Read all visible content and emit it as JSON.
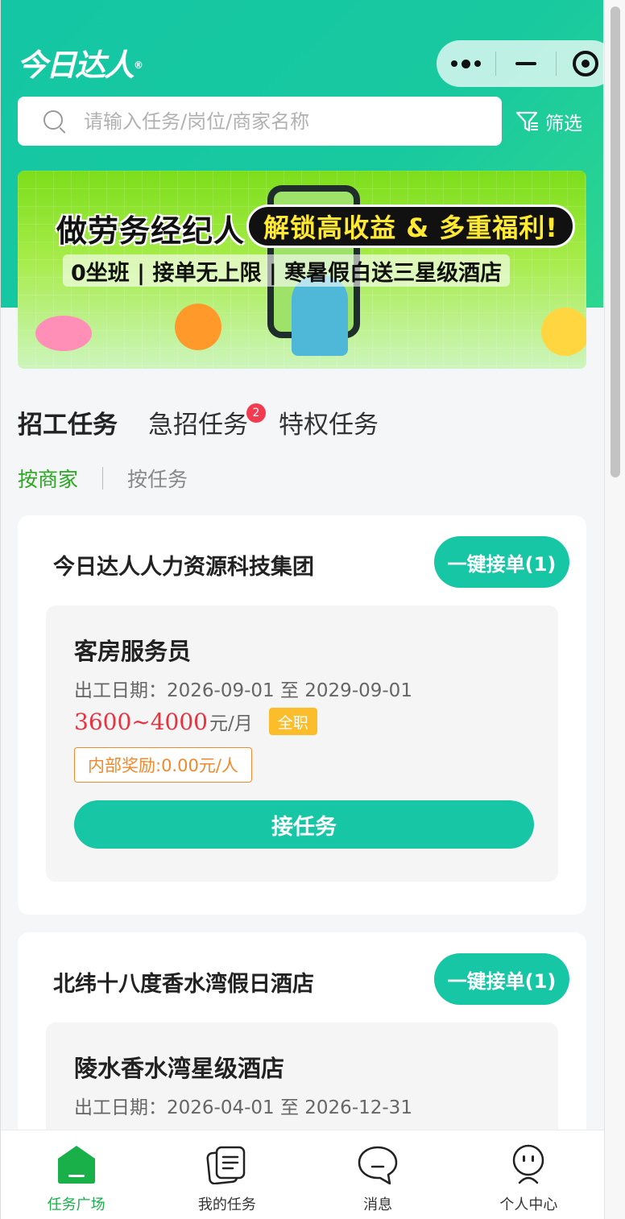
{
  "app": {
    "logo_text": "今日达人",
    "logo_mark": "®"
  },
  "capsule": {
    "more_icon": "more-dots-icon",
    "minimize_icon": "minimize-icon",
    "close_icon": "target-circle-icon"
  },
  "search": {
    "placeholder": "请输入任务/岗位/商家名称",
    "value": ""
  },
  "filter": {
    "label": "筛选"
  },
  "banner": {
    "headline": "做劳务经纪人",
    "pill": "解锁高收益 & 多重福利!",
    "subline": "0坐班 | 接单无上限 | 寒暑假白送三星级酒店"
  },
  "tabs": [
    {
      "label": "招工任务",
      "active": true
    },
    {
      "label": "急招任务",
      "badge": "2"
    },
    {
      "label": "特权任务"
    }
  ],
  "subtabs": [
    {
      "label": "按商家",
      "active": true
    },
    {
      "label": "按任务"
    }
  ],
  "cards": [
    {
      "merchant": "今日达人人力资源科技集团",
      "onekey": "一键接单(1)",
      "job": {
        "title": "客房服务员",
        "date": "出工日期：2026-09-01 至 2029-09-01",
        "salary": "3600~4000",
        "salary_unit": "元/月",
        "tag": "全职",
        "reward": "内部奖励:0.00元/人",
        "accept": "接任务"
      }
    },
    {
      "merchant": "北纬十八度香水湾假日酒店",
      "onekey": "一键接单(1)",
      "job": {
        "title": "陵水香水湾星级酒店",
        "date": "出工日期：2026-04-01 至 2026-12-31"
      }
    }
  ],
  "tabbar": [
    {
      "label": "任务广场",
      "icon": "home-icon",
      "active": true
    },
    {
      "label": "我的任务",
      "icon": "task-list-icon"
    },
    {
      "label": "消息",
      "icon": "message-icon"
    },
    {
      "label": "个人中心",
      "icon": "profile-icon"
    }
  ],
  "colors": {
    "brand": "#16c6a5",
    "active_tab_text": "#19b04a",
    "salary": "#e8323d",
    "reward": "#f08a2c",
    "tag": "#fbbd2a",
    "badge": "#f23b50"
  }
}
